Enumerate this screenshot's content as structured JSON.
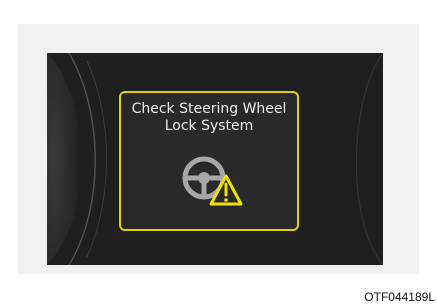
{
  "warning": {
    "line1": "Check Steering Wheel",
    "line2": "Lock System",
    "icon": "steering-wheel-warning-icon",
    "border_color": "#e1d100",
    "warning_color": "#f0e000"
  },
  "caption": "OTF044189L"
}
